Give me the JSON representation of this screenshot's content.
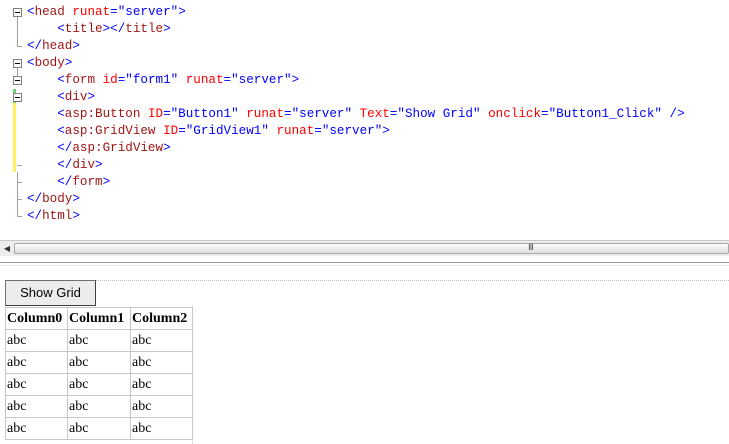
{
  "editor": {
    "lines": [
      {
        "indent": "",
        "tokens": [
          [
            "brk",
            "<"
          ],
          [
            "tag",
            "head"
          ],
          [
            "text",
            " "
          ],
          [
            "attr",
            "runat"
          ],
          [
            "brk",
            "="
          ],
          [
            "val",
            "\"server\""
          ],
          [
            "brk",
            ">"
          ]
        ]
      },
      {
        "indent": "    ",
        "tokens": [
          [
            "brk",
            "<"
          ],
          [
            "tag",
            "title"
          ],
          [
            "brk",
            "></"
          ],
          [
            "tag",
            "title"
          ],
          [
            "brk",
            ">"
          ]
        ]
      },
      {
        "indent": "",
        "tokens": [
          [
            "brk",
            "</"
          ],
          [
            "tag",
            "head"
          ],
          [
            "brk",
            ">"
          ]
        ]
      },
      {
        "indent": "",
        "tokens": [
          [
            "brk",
            "<"
          ],
          [
            "tag",
            "body"
          ],
          [
            "brk",
            ">"
          ]
        ]
      },
      {
        "indent": "    ",
        "tokens": [
          [
            "brk",
            "<"
          ],
          [
            "tag",
            "form"
          ],
          [
            "text",
            " "
          ],
          [
            "attr",
            "id"
          ],
          [
            "brk",
            "="
          ],
          [
            "val",
            "\"form1\""
          ],
          [
            "text",
            " "
          ],
          [
            "attr",
            "runat"
          ],
          [
            "brk",
            "="
          ],
          [
            "val",
            "\"server\""
          ],
          [
            "brk",
            ">"
          ]
        ]
      },
      {
        "indent": "    ",
        "tokens": [
          [
            "brk",
            "<"
          ],
          [
            "tag",
            "div"
          ],
          [
            "brk",
            ">"
          ]
        ]
      },
      {
        "indent": "    ",
        "tokens": [
          [
            "brk",
            "<"
          ],
          [
            "tag",
            "asp:Button"
          ],
          [
            "text",
            " "
          ],
          [
            "attr",
            "ID"
          ],
          [
            "brk",
            "="
          ],
          [
            "val",
            "\"Button1\""
          ],
          [
            "text",
            " "
          ],
          [
            "attr",
            "runat"
          ],
          [
            "brk",
            "="
          ],
          [
            "val",
            "\"server\""
          ],
          [
            "text",
            " "
          ],
          [
            "attr",
            "Text"
          ],
          [
            "brk",
            "="
          ],
          [
            "val",
            "\"Show Grid\""
          ],
          [
            "text",
            " "
          ],
          [
            "attr",
            "onclick"
          ],
          [
            "brk",
            "="
          ],
          [
            "val",
            "\"Button1_Click\""
          ],
          [
            "text",
            " "
          ],
          [
            "brk",
            "/>"
          ]
        ]
      },
      {
        "indent": "    ",
        "tokens": [
          [
            "brk",
            "<"
          ],
          [
            "tag",
            "asp:GridView"
          ],
          [
            "text",
            " "
          ],
          [
            "attr",
            "ID"
          ],
          [
            "brk",
            "="
          ],
          [
            "val",
            "\"GridView1\""
          ],
          [
            "text",
            " "
          ],
          [
            "attr",
            "runat"
          ],
          [
            "brk",
            "="
          ],
          [
            "val",
            "\"server\""
          ],
          [
            "brk",
            ">"
          ]
        ]
      },
      {
        "indent": "    ",
        "tokens": [
          [
            "brk",
            "</"
          ],
          [
            "tag",
            "asp:GridView"
          ],
          [
            "brk",
            ">"
          ]
        ]
      },
      {
        "indent": "    ",
        "tokens": [
          [
            "brk",
            "</"
          ],
          [
            "tag",
            "div"
          ],
          [
            "brk",
            ">"
          ]
        ]
      },
      {
        "indent": "    ",
        "tokens": [
          [
            "brk",
            "</"
          ],
          [
            "tag",
            "form"
          ],
          [
            "brk",
            ">"
          ]
        ]
      },
      {
        "indent": "",
        "tokens": [
          [
            "brk",
            "</"
          ],
          [
            "tag",
            "body"
          ],
          [
            "brk",
            ">"
          ]
        ]
      },
      {
        "indent": "",
        "tokens": [
          [
            "brk",
            "</"
          ],
          [
            "tag",
            "html"
          ],
          [
            "brk",
            ">"
          ]
        ]
      }
    ],
    "colors": {
      "tag": "#a31515",
      "bracket": "#0000ff",
      "attribute": "#ff0000",
      "value": "#0000ff"
    }
  },
  "scrollbar": {
    "left_arrow_icon": "arrow-left-icon",
    "grip_glyph": "III"
  },
  "design": {
    "button_label": "Show Grid",
    "grid": {
      "headers": [
        "Column0",
        "Column1",
        "Column2"
      ],
      "rows": [
        [
          "abc",
          "abc",
          "abc"
        ],
        [
          "abc",
          "abc",
          "abc"
        ],
        [
          "abc",
          "abc",
          "abc"
        ],
        [
          "abc",
          "abc",
          "abc"
        ],
        [
          "abc",
          "abc",
          "abc"
        ]
      ]
    }
  }
}
